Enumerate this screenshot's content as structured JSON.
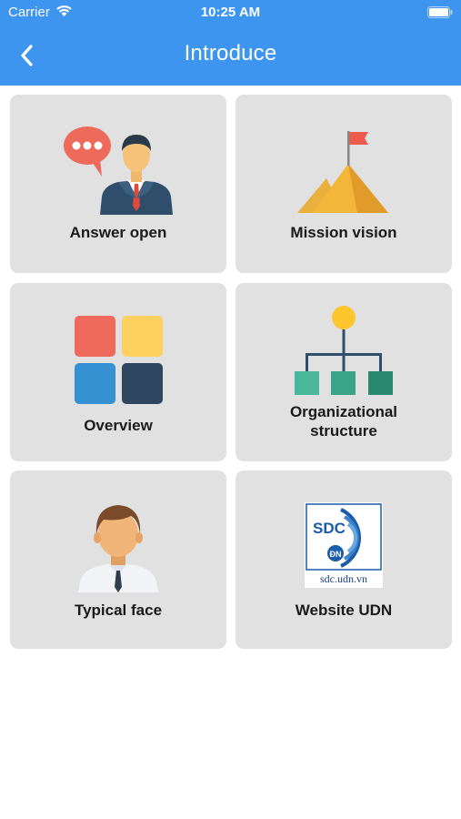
{
  "status_bar": {
    "carrier": "Carrier",
    "time": "10:25 AM",
    "wifi_icon": "wifi-icon",
    "battery_icon": "battery-icon"
  },
  "nav": {
    "title": "Introduce",
    "back_icon": "chevron-left-icon"
  },
  "colors": {
    "header": "#3d95f0",
    "card": "#e1e1e1"
  },
  "cards": [
    {
      "label": "Answer open",
      "icon": "chat-businessman-icon"
    },
    {
      "label": "Mission vision",
      "icon": "mountain-flag-icon"
    },
    {
      "label": "Overview",
      "icon": "color-tiles-icon"
    },
    {
      "label": "Organizational structure",
      "icon": "org-chart-icon"
    },
    {
      "label": "Typical face",
      "icon": "person-icon"
    },
    {
      "label": "Website UDN",
      "icon": "sdc-logo-icon",
      "logo_text": "SDC",
      "logo_badge": "ĐN",
      "logo_url": "sdc.udn.vn"
    }
  ]
}
